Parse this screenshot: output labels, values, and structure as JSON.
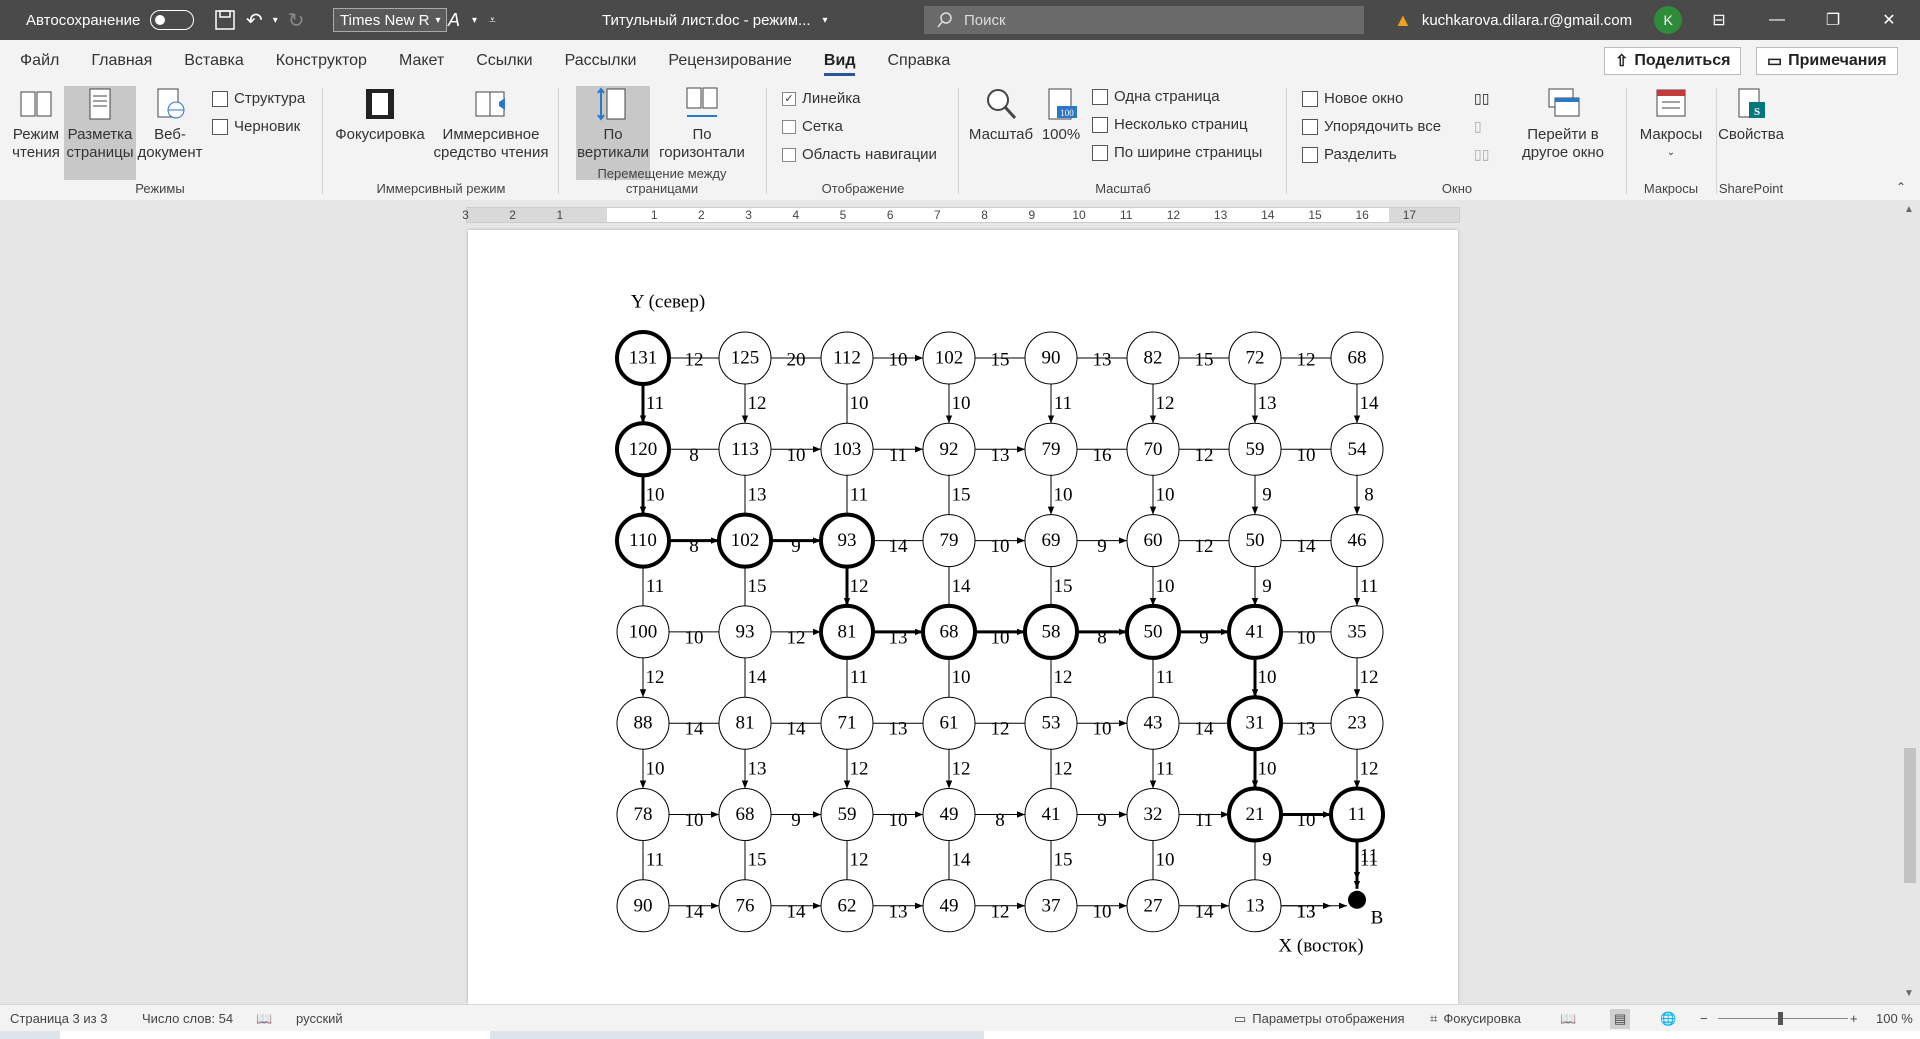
{
  "titlebar": {
    "autosave_label": "Автосохранение",
    "font_name": "Times New R",
    "doc_title": "Титульный лист.doc  -  режим...",
    "search_placeholder": "Поиск",
    "user_email": "kuchkarova.dilara.r@gmail.com",
    "avatar_letter": "K"
  },
  "menu": {
    "tabs": [
      "Файл",
      "Главная",
      "Вставка",
      "Конструктор",
      "Макет",
      "Ссылки",
      "Рассылки",
      "Рецензирование",
      "Вид",
      "Справка"
    ],
    "active": "Вид",
    "share_label": "Поделиться",
    "comments_label": "Примечания"
  },
  "ribbon": {
    "modes": {
      "label": "Режимы",
      "read": "Режим\nчтения",
      "layout": "Разметка\nстраницы",
      "web": "Веб-\nдокумент",
      "outline": "Структура",
      "draft": "Черновик"
    },
    "immersive": {
      "label": "Иммерсивный режим",
      "focus": "Фокусировка",
      "reader": "Иммерсивное\nсредство чтения"
    },
    "movement": {
      "label": "Перемещение между страницами",
      "vertical": "По\nвертикали",
      "horizontal": "По\nгоризонтали"
    },
    "show": {
      "label": "Отображение",
      "ruler": "Линейка",
      "ruler_checked": true,
      "grid": "Сетка",
      "grid_checked": false,
      "nav": "Область навигации",
      "nav_checked": false
    },
    "zoom": {
      "label": "Масштаб",
      "zoom": "Масштаб",
      "hundred": "100%",
      "one_page": "Одна страница",
      "multi_page": "Несколько страниц",
      "page_width": "По ширине страницы"
    },
    "window": {
      "label": "Окно",
      "new_window": "Новое окно",
      "arrange": "Упорядочить все",
      "split": "Разделить",
      "switch": "Перейти в\nдругое окно"
    },
    "macros": {
      "label": "Макросы",
      "macros": "Макросы"
    },
    "sharepoint": {
      "label": "SharePoint",
      "props": "Свойства"
    }
  },
  "ruler": {
    "numbers": [
      "3",
      "2",
      "1",
      "1",
      "2",
      "3",
      "4",
      "5",
      "6",
      "7",
      "8",
      "9",
      "10",
      "11",
      "12",
      "13",
      "14",
      "15",
      "16",
      "17"
    ]
  },
  "diagram": {
    "y_label": "Y (север)",
    "x_label": "X (восток)",
    "end_label": "B",
    "nodes": [
      [
        131,
        125,
        112,
        102,
        90,
        82,
        72,
        68
      ],
      [
        120,
        113,
        103,
        92,
        79,
        70,
        59,
        54
      ],
      [
        110,
        102,
        93,
        79,
        69,
        60,
        50,
        46
      ],
      [
        100,
        93,
        81,
        68,
        58,
        50,
        41,
        35
      ],
      [
        88,
        81,
        71,
        61,
        53,
        43,
        31,
        23
      ],
      [
        78,
        68,
        59,
        49,
        41,
        32,
        21,
        11
      ],
      [
        90,
        76,
        62,
        49,
        37,
        27,
        13
      ]
    ],
    "h_weights": [
      [
        12,
        20,
        10,
        15,
        13,
        15,
        12
      ],
      [
        8,
        10,
        11,
        13,
        16,
        12,
        10
      ],
      [
        8,
        9,
        14,
        10,
        9,
        12,
        14
      ],
      [
        10,
        12,
        13,
        10,
        8,
        9,
        10
      ],
      [
        14,
        14,
        13,
        12,
        10,
        14,
        13
      ],
      [
        10,
        9,
        10,
        8,
        9,
        11,
        10
      ],
      [
        14,
        14,
        13,
        12,
        10,
        14,
        13
      ]
    ],
    "v_weights": [
      [
        11,
        12,
        10,
        10,
        11,
        12,
        13,
        14
      ],
      [
        10,
        13,
        11,
        15,
        10,
        10,
        9,
        8
      ],
      [
        11,
        15,
        12,
        14,
        15,
        10,
        9,
        11
      ],
      [
        12,
        14,
        11,
        10,
        12,
        11,
        10,
        12
      ],
      [
        10,
        13,
        12,
        12,
        12,
        11,
        10,
        12
      ],
      [
        11,
        15,
        12,
        14,
        15,
        10,
        9,
        11
      ]
    ],
    "h_arrows": [
      [
        0,
        0,
        1,
        0,
        0,
        0,
        0
      ],
      [
        0,
        1,
        1,
        1,
        0,
        0,
        0
      ],
      [
        1,
        1,
        0,
        1,
        1,
        0,
        0
      ],
      [
        0,
        1,
        1,
        1,
        1,
        1,
        0
      ],
      [
        0,
        0,
        0,
        0,
        1,
        0,
        0
      ],
      [
        1,
        1,
        1,
        1,
        1,
        1,
        1
      ],
      [
        1,
        1,
        1,
        1,
        1,
        1,
        1
      ]
    ],
    "v_arrows": [
      [
        1,
        1,
        0,
        1,
        1,
        1,
        1,
        1
      ],
      [
        1,
        0,
        0,
        0,
        1,
        1,
        1,
        1
      ],
      [
        0,
        0,
        1,
        0,
        0,
        1,
        1,
        1
      ],
      [
        1,
        0,
        0,
        0,
        0,
        0,
        1,
        1
      ],
      [
        1,
        1,
        1,
        1,
        0,
        1,
        1,
        1
      ],
      [
        0,
        0,
        0,
        0,
        0,
        0,
        0,
        1
      ]
    ],
    "bold_nodes": [
      [
        0,
        0
      ],
      [
        1,
        0
      ],
      [
        2,
        0
      ],
      [
        2,
        1
      ],
      [
        2,
        2
      ],
      [
        3,
        2
      ],
      [
        3,
        3
      ],
      [
        3,
        4
      ],
      [
        3,
        5
      ],
      [
        3,
        6
      ],
      [
        4,
        6
      ],
      [
        5,
        6
      ],
      [
        5,
        7
      ]
    ],
    "bold_h": [
      [
        2,
        0
      ],
      [
        2,
        1
      ],
      [
        3,
        2
      ],
      [
        3,
        3
      ],
      [
        3,
        4
      ],
      [
        3,
        5
      ],
      [
        5,
        6
      ]
    ],
    "bold_v": [
      [
        0,
        0
      ],
      [
        1,
        0
      ],
      [
        2,
        2
      ],
      [
        3,
        6
      ],
      [
        4,
        6
      ],
      [
        5,
        7
      ]
    ]
  },
  "status": {
    "page": "Страница 3 из 3",
    "words": "Число слов: 54",
    "language": "русский",
    "display_settings": "Параметры отображения",
    "focus": "Фокусировка",
    "zoom": "100 %"
  }
}
